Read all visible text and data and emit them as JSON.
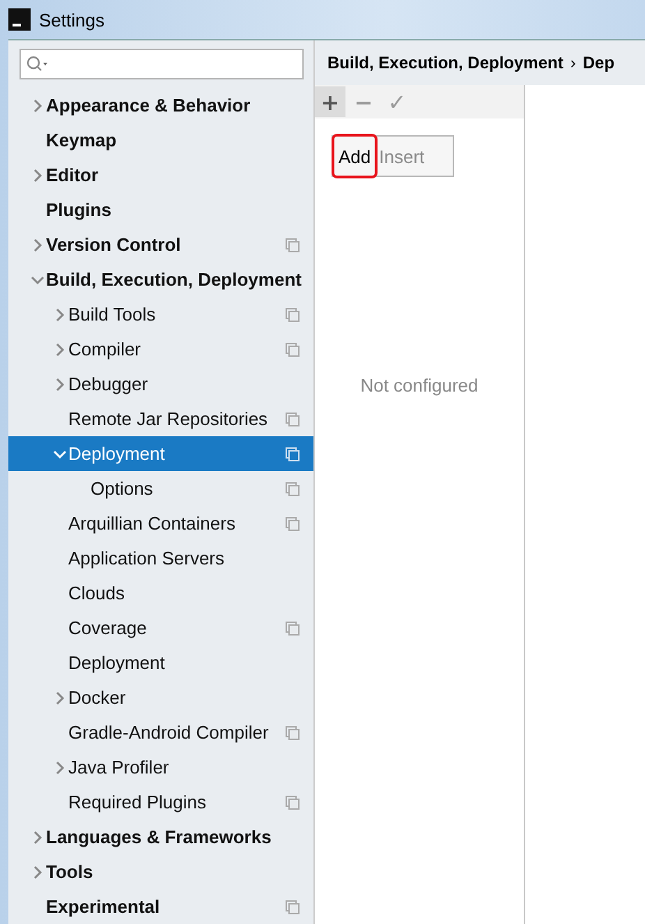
{
  "window": {
    "title": "Settings"
  },
  "tree": [
    {
      "label": "Appearance & Behavior",
      "expanded": false,
      "project_level": false,
      "selected": false
    },
    {
      "label": "Keymap",
      "project_level": false,
      "selected": false
    },
    {
      "label": "Editor",
      "expanded": false,
      "project_level": false,
      "selected": false
    },
    {
      "label": "Plugins",
      "project_level": false,
      "selected": false
    },
    {
      "label": "Version Control",
      "expanded": false,
      "project_level": true,
      "selected": false
    },
    {
      "label": "Build, Execution, Deployment",
      "expanded": true,
      "project_level": false,
      "selected": false,
      "children": [
        {
          "label": "Build Tools",
          "expanded": false,
          "project_level": true,
          "selected": false
        },
        {
          "label": "Compiler",
          "expanded": false,
          "project_level": true,
          "selected": false
        },
        {
          "label": "Debugger",
          "expanded": false,
          "project_level": false,
          "selected": false
        },
        {
          "label": "Remote Jar Repositories",
          "project_level": true,
          "selected": false
        },
        {
          "label": "Deployment",
          "expanded": true,
          "project_level": true,
          "selected": true,
          "children": [
            {
              "label": "Options",
              "project_level": true,
              "selected": false
            }
          ]
        },
        {
          "label": "Arquillian Containers",
          "project_level": true,
          "selected": false
        },
        {
          "label": "Application Servers",
          "project_level": false,
          "selected": false
        },
        {
          "label": "Clouds",
          "project_level": false,
          "selected": false
        },
        {
          "label": "Coverage",
          "project_level": true,
          "selected": false
        },
        {
          "label": "Deployment",
          "project_level": false,
          "selected": false
        },
        {
          "label": "Docker",
          "expanded": false,
          "project_level": false,
          "selected": false
        },
        {
          "label": "Gradle-Android Compiler",
          "project_level": true,
          "selected": false
        },
        {
          "label": "Java Profiler",
          "expanded": false,
          "project_level": false,
          "selected": false
        },
        {
          "label": "Required Plugins",
          "project_level": true,
          "selected": false
        }
      ]
    },
    {
      "label": "Languages & Frameworks",
      "expanded": false,
      "project_level": false,
      "selected": false
    },
    {
      "label": "Tools",
      "expanded": false,
      "project_level": false,
      "selected": false
    },
    {
      "label": "Experimental",
      "project_level": true,
      "selected": false
    }
  ],
  "breadcrumb": [
    "Build, Execution, Deployment",
    "Dep"
  ],
  "breadcrumb_separator": "›",
  "toolbar": [
    {
      "icon": "+",
      "disabled": false,
      "selected": true
    },
    {
      "icon": "−",
      "disabled": true,
      "selected": false
    },
    {
      "icon": "✓",
      "disabled": true,
      "selected": false
    }
  ],
  "popup_menu": [
    {
      "label": "Add",
      "selected": true
    },
    {
      "label": "Insert",
      "selected": false
    }
  ],
  "empty_text": "Not configured"
}
